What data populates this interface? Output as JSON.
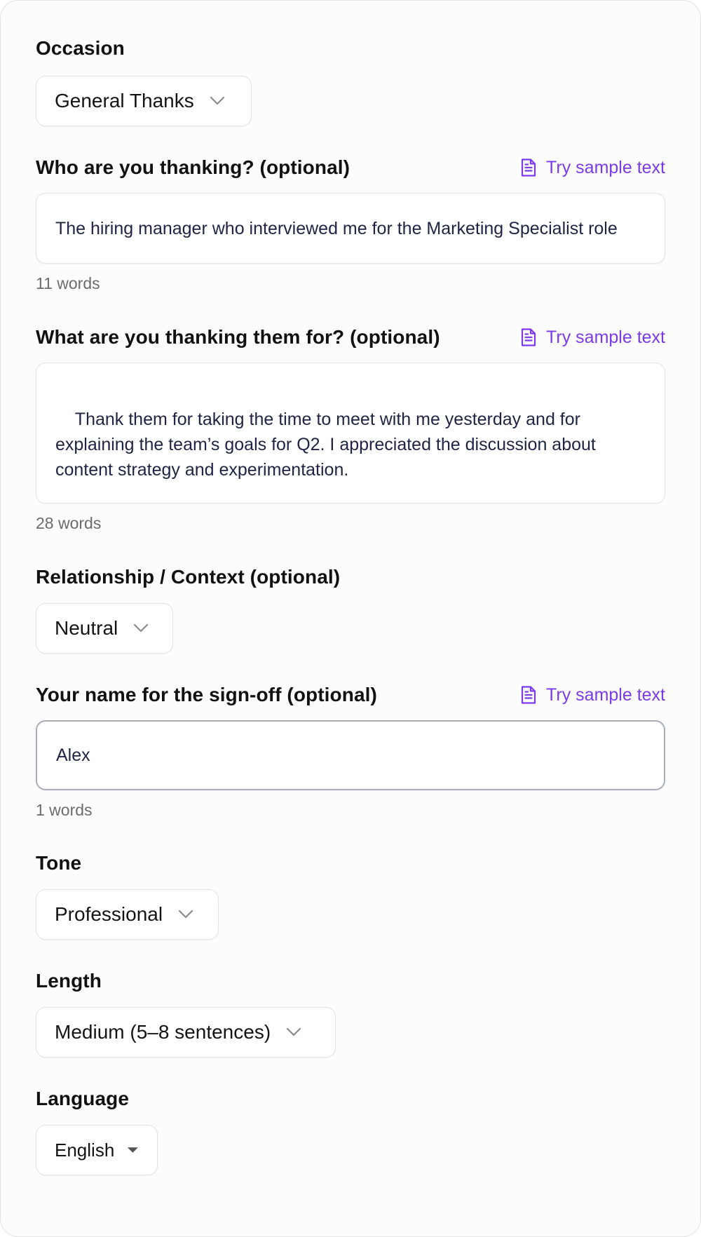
{
  "occasion": {
    "label": "Occasion",
    "selected": "General Thanks"
  },
  "recipient": {
    "label": "Who are you thanking? (optional)",
    "sample_link": "Try sample text",
    "value": "The hiring manager who interviewed me for the Marketing Specialist role",
    "word_count": "11 words"
  },
  "reason": {
    "label": "What are you thanking them for? (optional)",
    "sample_link": "Try sample text",
    "value": "Thank them for taking the time to meet with me yesterday and for\nexplaining the team’s goals for Q2. I appreciated the discussion about\ncontent strategy and experimentation.",
    "word_count": "28 words"
  },
  "relationship": {
    "label": "Relationship / Context (optional)",
    "selected": "Neutral"
  },
  "signoff": {
    "label": "Your name for the sign-off (optional)",
    "sample_link": "Try sample text",
    "value": "Alex",
    "word_count": "1 words"
  },
  "tone": {
    "label": "Tone",
    "selected": "Professional"
  },
  "length": {
    "label": "Length",
    "selected": "Medium (5–8 sentences)"
  },
  "language": {
    "label": "Language",
    "selected": "English"
  },
  "colors": {
    "accent": "#7c3aed",
    "input_text": "#1f2445",
    "muted": "#6b6b70",
    "border": "#e3e3e6"
  },
  "icons": {
    "sample": "document-icon",
    "dropdown": "chevron-down-icon",
    "native_dropdown": "caret-down-icon"
  }
}
